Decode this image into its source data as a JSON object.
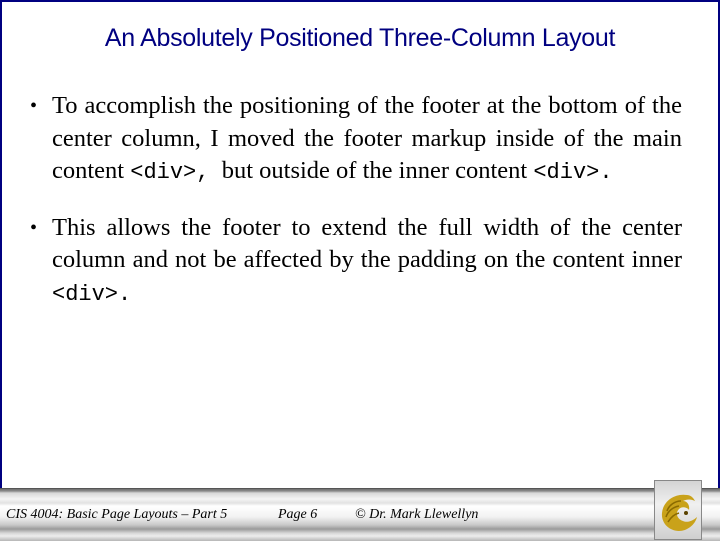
{
  "slide": {
    "title": "An Absolutely Positioned Three-Column Layout",
    "bullets": [
      {
        "marker": "•",
        "parts": [
          {
            "text": "To accomplish the positioning of the footer at the bottom of the center column, I moved the footer markup inside of the main content ",
            "code": false
          },
          {
            "text": "<div>,",
            "code": true
          },
          {
            "text": "  but outside of the inner content ",
            "code": false
          },
          {
            "text": "<div>.",
            "code": true
          }
        ]
      },
      {
        "marker": "•",
        "parts": [
          {
            "text": "This allows the footer to extend the full width of the center column and not be affected by the padding on the content inner ",
            "code": false
          },
          {
            "text": "<div>.",
            "code": true
          }
        ]
      }
    ]
  },
  "footer": {
    "course": "CIS 4004: Basic Page Layouts – Part 5",
    "page": "Page 6",
    "copyright": "© Dr. Mark Llewellyn",
    "logo_icon": "pegasus-logo-icon"
  },
  "colors": {
    "title": "#000080",
    "frame_border": "#000080",
    "logo_gold": "#c9a21a"
  }
}
